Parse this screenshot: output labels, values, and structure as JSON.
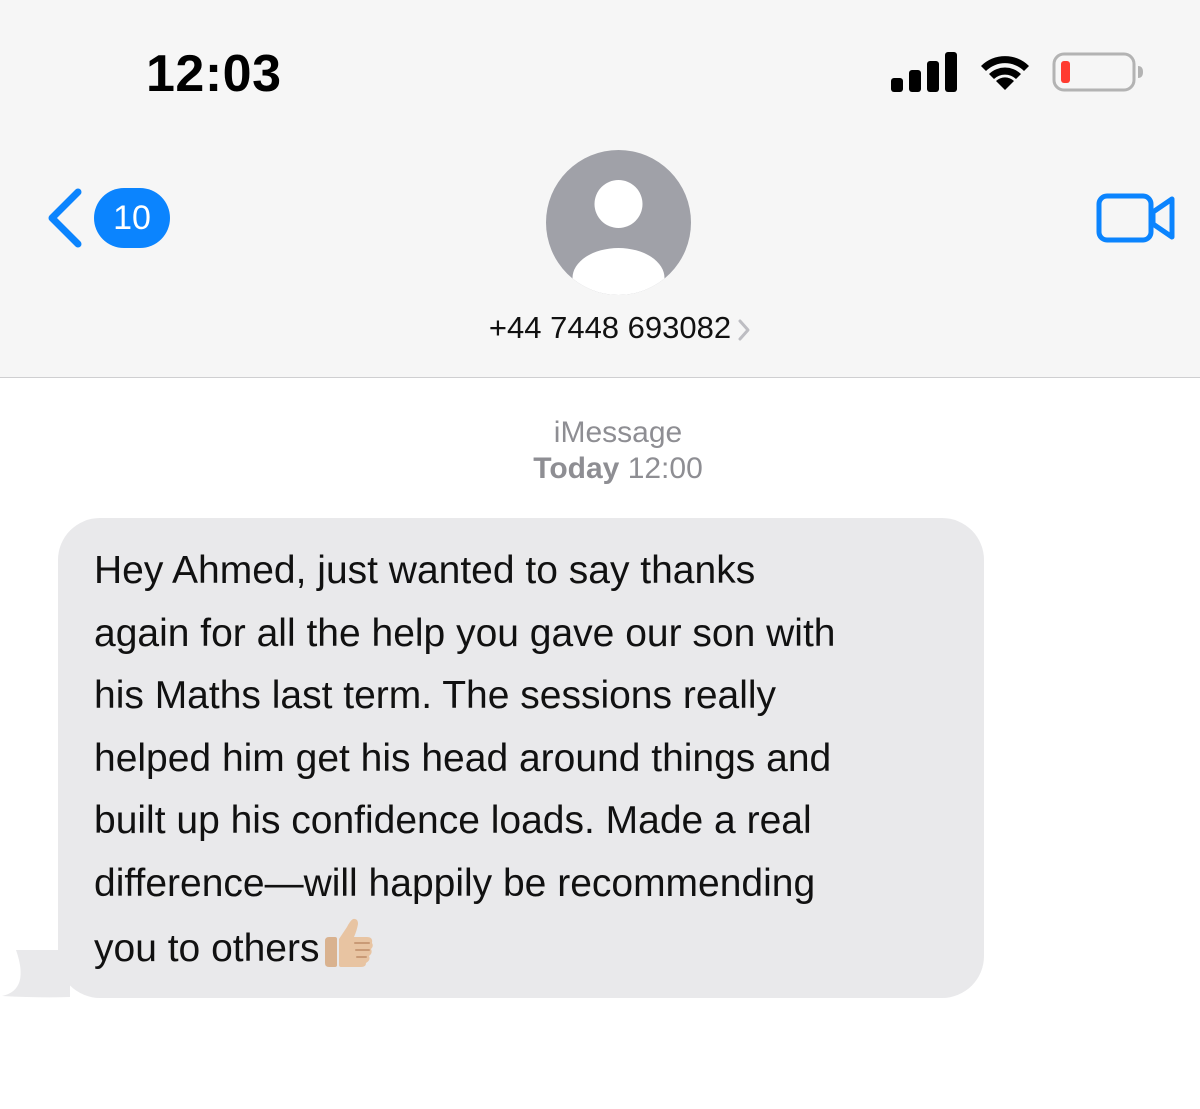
{
  "status_bar": {
    "time": "12:03",
    "signal_icon": "signal-bars-icon",
    "wifi_icon": "wifi-icon",
    "battery_icon": "battery-low-icon",
    "battery_color": "#ff3b30"
  },
  "nav": {
    "back_icon": "chevron-left-icon",
    "unread_count": "10",
    "contact": "+44 7448 693082",
    "avatar_icon": "person-placeholder-icon",
    "detail_icon": "chevron-right-icon",
    "video_icon": "video-camera-icon",
    "accent_color": "#0b84fe"
  },
  "conversation": {
    "service_label": "iMessage",
    "date_label": "Today",
    "time_label": "12:00",
    "messages": [
      {
        "direction": "incoming",
        "lines": [
          "Hey Ahmed, just wanted to say thanks",
          "again for all the help you gave our son with",
          "his Maths last term. The sessions really",
          "helped him get his head around things and",
          "built up his confidence loads. Made a real",
          "difference—will happily be recommending",
          "you to others"
        ],
        "emoji": "thumbs-up-icon",
        "bubble_color": "#e9e9eb"
      }
    ]
  }
}
